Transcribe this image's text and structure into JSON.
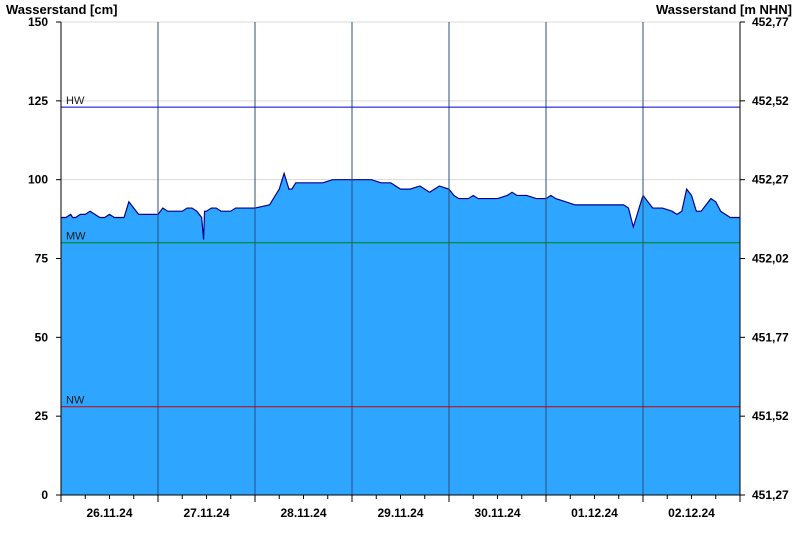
{
  "chart_data": {
    "type": "area",
    "ylabel_left": "Wasserstand [cm]",
    "ylabel_right": "Wasserstand [m NHN]",
    "ylim": [
      0,
      150
    ],
    "y_ticks": [
      0,
      25,
      50,
      75,
      100,
      125,
      150
    ],
    "y2_ticks": [
      "451,27",
      "451,52",
      "451,77",
      "452,02",
      "452,27",
      "452,52",
      "452,77"
    ],
    "x_ticks": [
      "26.11.24",
      "27.11.24",
      "28.11.24",
      "29.11.24",
      "30.11.24",
      "01.12.24",
      "02.12.24"
    ],
    "x_range_days": [
      0,
      7
    ],
    "grid": true,
    "reference_lines": [
      {
        "label": "HW",
        "value": 123,
        "color": "#0000cc"
      },
      {
        "label": "MW",
        "value": 80,
        "color": "#008000"
      },
      {
        "label": "NW",
        "value": 28,
        "color": "#cc0000"
      }
    ],
    "fill_color": "#2ea6ff",
    "line_color": "#00008b",
    "series": [
      {
        "x": [
          0,
          0.05,
          0.1,
          0.12,
          0.15,
          0.2,
          0.25,
          0.3,
          0.4,
          0.45,
          0.5,
          0.55,
          0.6,
          0.65,
          0.7,
          0.8,
          0.85,
          0.9,
          1.0,
          1.05,
          1.1,
          1.15,
          1.2,
          1.25,
          1.3,
          1.35,
          1.4,
          1.45,
          1.47,
          1.48,
          1.5,
          1.55,
          1.6,
          1.65,
          1.7,
          1.75,
          1.8,
          1.85,
          2.0,
          2.15,
          2.25,
          2.3,
          2.35,
          2.38,
          2.4,
          2.42,
          2.45,
          2.5,
          2.6,
          2.7,
          2.8,
          2.9,
          3.0,
          3.2,
          3.3,
          3.4,
          3.5,
          3.6,
          3.7,
          3.8,
          3.9,
          4.0,
          4.05,
          4.1,
          4.15,
          4.2,
          4.25,
          4.3,
          4.4,
          4.5,
          4.6,
          4.65,
          4.7,
          4.8,
          4.9,
          5.0,
          5.05,
          5.1,
          5.2,
          5.3,
          5.5,
          5.6,
          5.7,
          5.8,
          5.85,
          5.9,
          5.95,
          6.0,
          6.05,
          6.1,
          6.2,
          6.3,
          6.35,
          6.4,
          6.45,
          6.5,
          6.55,
          6.6,
          6.65,
          6.7,
          6.75,
          6.8,
          6.85,
          6.9,
          6.95,
          7.0
        ],
        "y": [
          88,
          88,
          89,
          88,
          88,
          89,
          89,
          90,
          88,
          88,
          89,
          88,
          88,
          88,
          93,
          89,
          89,
          89,
          89,
          91,
          90,
          90,
          90,
          90,
          91,
          91,
          90,
          88,
          81,
          90,
          90,
          91,
          91,
          90,
          90,
          90,
          91,
          91,
          91,
          92,
          97,
          102,
          97,
          97,
          98,
          99,
          99,
          99,
          99,
          99,
          100,
          100,
          100,
          100,
          99,
          99,
          97,
          97,
          98,
          96,
          98,
          97,
          95,
          94,
          94,
          94,
          95,
          94,
          94,
          94,
          95,
          96,
          95,
          95,
          94,
          94,
          95,
          94,
          93,
          92,
          92,
          92,
          92,
          92,
          91,
          85,
          90,
          95,
          93,
          91,
          91,
          90,
          89,
          90,
          97,
          95,
          90,
          90,
          92,
          94,
          93,
          90,
          89,
          88,
          88,
          88
        ]
      }
    ]
  }
}
